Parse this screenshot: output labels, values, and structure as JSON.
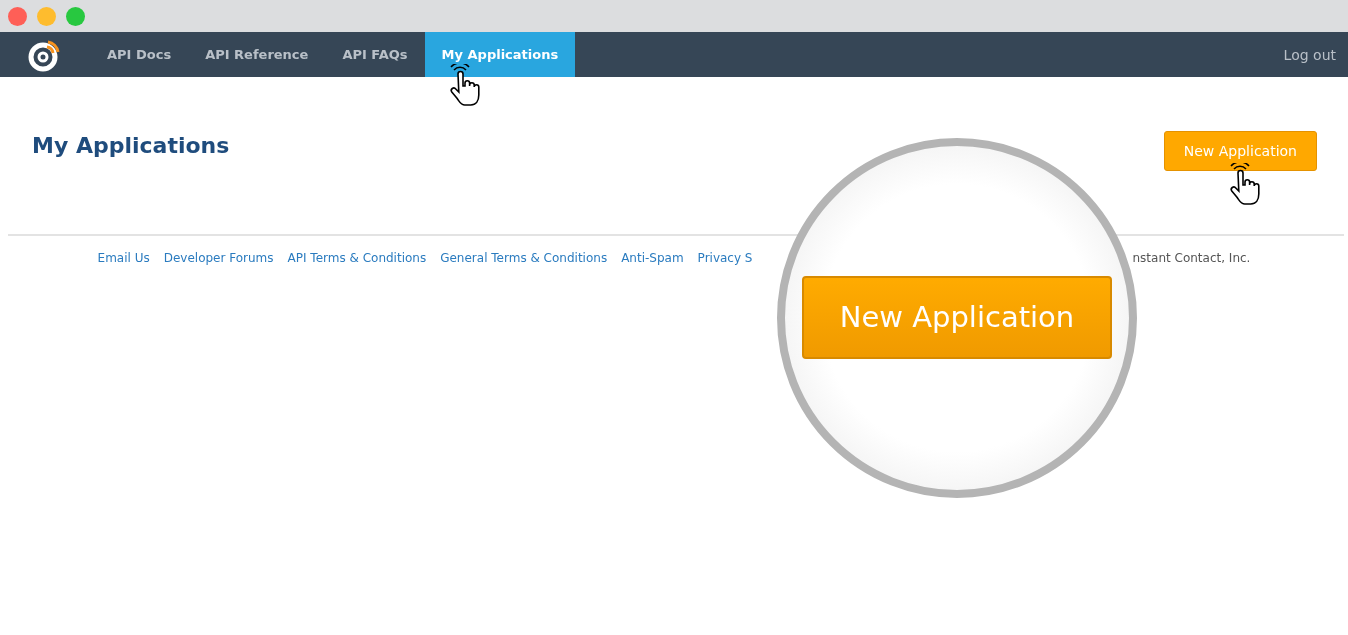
{
  "nav": {
    "tabs": [
      {
        "label": "API Docs",
        "selected": false
      },
      {
        "label": "API Reference",
        "selected": false
      },
      {
        "label": "API FAQs",
        "selected": false
      },
      {
        "label": "My Applications",
        "selected": true
      }
    ],
    "logout": "Log out"
  },
  "page": {
    "title": "My Applications",
    "button": "New Application"
  },
  "footer": {
    "links": [
      "Email Us",
      "Developer Forums",
      "API Terms & Conditions",
      "General Terms & Conditions",
      "Anti-Spam",
      "Privacy S"
    ],
    "copyright": "nstant Contact, Inc."
  },
  "magnifier": {
    "button": "New Application"
  }
}
